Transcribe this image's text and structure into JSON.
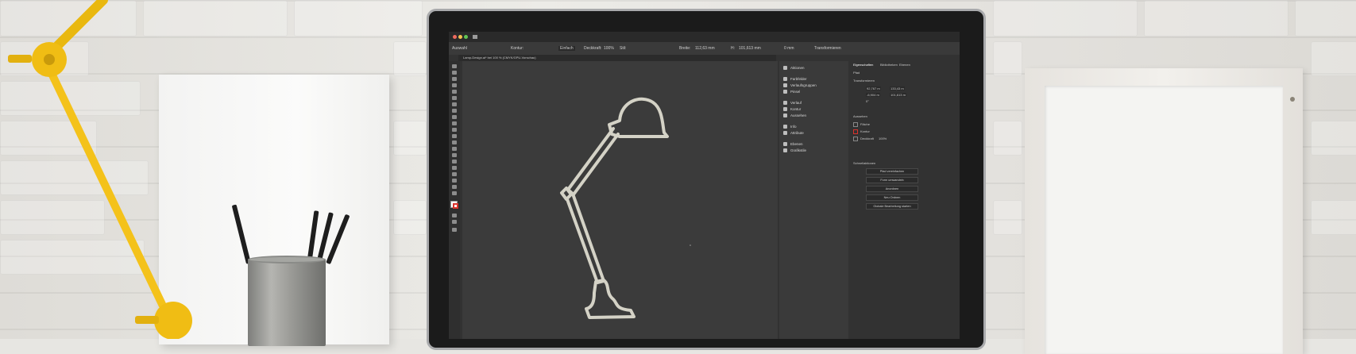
{
  "ai_window": {
    "document_tab": "Lamp-Design.ai* bei 100 % (CMYK/GPU-Vorschau)",
    "control_bar": [
      "Auswahl",
      "Kontur:",
      "Einfach",
      "Deckkraft:",
      "100%",
      "Stil:",
      "Breite:",
      "112,63 mm",
      "H:",
      "101,613 mm",
      "0 mm",
      "Transformieren"
    ],
    "middle_panel": [
      "Aktionen",
      "Farbfelder",
      "Verlaufsgruppen",
      "Pinsel",
      "Verlauf",
      "Kontur",
      "Aussehen",
      "Info",
      "Attribute",
      "Ebenen",
      "Grafikstile"
    ],
    "right_panel": {
      "tabs": [
        "Eigenschaften",
        "Bibliotheken",
        "Ebenen"
      ],
      "section_path": "Pfad",
      "section_transform": "Transformieren",
      "transform_values": [
        "92,767 m",
        "133,43 m",
        "-6,904 m",
        "101,613 m",
        "0°"
      ],
      "section_appearance": "Aussehen",
      "appearance_rows": [
        "Fläche",
        "Kontur",
        "Deckkraft",
        "100%"
      ],
      "section_quick_actions": "Schnellaktionen",
      "quick_actions": [
        "Pfad vereinfachen",
        "Form umwandeln",
        "Anordnen",
        "Neu Ordnen",
        "Globale Bearbeitung starten"
      ]
    }
  },
  "colors": {
    "lamp_yellow": "#f4c21a",
    "screen_bg": "#323232",
    "lamp_outline": "#d4d2c6"
  }
}
